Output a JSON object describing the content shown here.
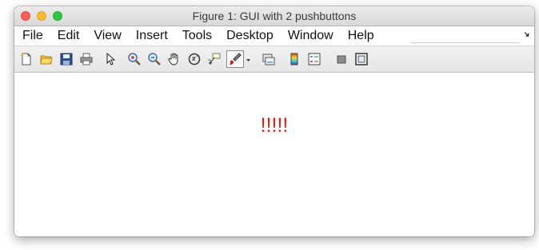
{
  "window": {
    "title": "Figure 1: GUI with 2 pushbuttons"
  },
  "menu": [
    "File",
    "Edit",
    "View",
    "Insert",
    "Tools",
    "Desktop",
    "Window",
    "Help"
  ],
  "toolbar": {
    "icons": [
      "new-figure",
      "open-file",
      "save",
      "print",
      "pointer",
      "zoom-in",
      "zoom-out",
      "pan",
      "rotate-3d",
      "data-cursor",
      "brush",
      "brush-dropdown",
      "link-plot",
      "colorbar",
      "legend",
      "hide-plot-tools",
      "show-plot-tools"
    ]
  },
  "content": {
    "text": "!!!!!"
  },
  "colors": {
    "text": "#dd1f17"
  }
}
